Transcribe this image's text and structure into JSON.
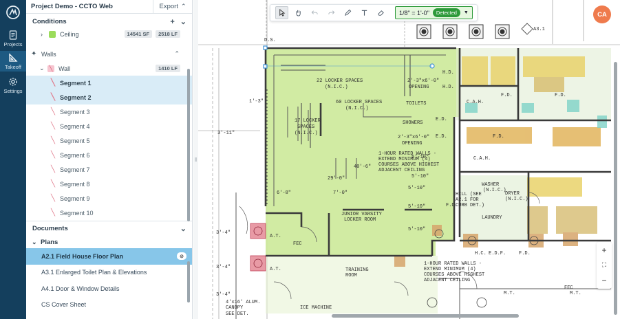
{
  "rail": {
    "items": [
      {
        "label": "Projects"
      },
      {
        "label": "Takeoff"
      },
      {
        "label": "Settings"
      }
    ]
  },
  "panel": {
    "title": "Project Demo - CCTO Web",
    "export_label": "Export",
    "conditions_title": "Conditions",
    "ceiling_label": "Ceiling",
    "ceiling_area": "14541 SF",
    "ceiling_length": "2518 LF",
    "walls_label": "Walls",
    "wall_label": "Wall",
    "wall_length": "1410 LF",
    "segments": [
      "Segment 1",
      "Segment 2",
      "Segment 3",
      "Segment 4",
      "Segment 5",
      "Segment 6",
      "Segment 7",
      "Segment 8",
      "Segment 9",
      "Segment 10"
    ],
    "documents_title": "Documents",
    "plans_title": "Plans",
    "plans": [
      "A2.1 Field House Floor Plan",
      "A3.1 Enlarged Toilet Plan & Elevations",
      "A4.1 Door & Window Details",
      "CS Cover Sheet"
    ]
  },
  "toolbar": {
    "scale_value": "1/8\" = 1'-0\"",
    "scale_status": "Detected"
  },
  "user": {
    "initials": "CA"
  },
  "zoom": {
    "in": "+",
    "fit": "⛶",
    "out": "−"
  },
  "plan": {
    "labels": [
      "22 LOCKER SPACES",
      "(N.I.C.)",
      "2'-3\"x6'-0\"",
      "OPENING",
      "60 LOCKER SPACES",
      "(N.I.C.)",
      "TOILETS",
      "SHOWERS",
      "17 LOCKER",
      "SPACES",
      "(N.I.C.)",
      "2'-3\"x6'-0\"",
      "OPENING",
      "1-HOUR RATED WALLS -",
      "EXTEND MINIMUM (4)",
      "COURSES ABOVE HIGHEST",
      "ADJACENT CEILING",
      "40'-6\"",
      "29'-0\"",
      "6'-8\"",
      "7'-0\"",
      "5'-10\"",
      "5'-10\"",
      "5'-10\"",
      "JUNIOR VARSITY",
      "LOCKER ROOM",
      "F.D.",
      "WASHER",
      "(N.I.C.)",
      "DRYER",
      "(N.I.C.)",
      "LAUNDRY",
      "1-HOUR RATED WALLS -",
      "EXTEND MINIMUM (4)",
      "COURSES ABOVE HIGHEST",
      "ADJACENT CEILING",
      "FEC",
      "TRAINING",
      "ROOM",
      "ICE MACHINE",
      "4'x16' ALUM.",
      "CANOPY",
      "SEE DET.",
      "1'-3\"",
      "3'-11\"",
      "A.T.",
      "A.T.",
      "5'-10\"",
      "5'-10\"",
      "C.A.H.",
      "F.D.",
      "F.D.",
      "C.A.H.",
      "F.D.",
      "E.D.",
      "E.D.",
      "H.D.",
      "H.D.",
      "FEC",
      "M.T.",
      "M.T.",
      "E.D.F.",
      "H.C.",
      "F.D.",
      "HILL (SEE",
      "A2.1 FOR",
      "CURB DET.)",
      "D.S.",
      "A3.1",
      "3'-4\"",
      "3'-4\"",
      "3'-4\""
    ]
  }
}
